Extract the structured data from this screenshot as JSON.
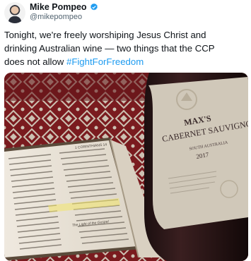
{
  "tweet": {
    "author_name": "Mike Pompeo",
    "handle": "@mikepompeo",
    "text_lines": [
      "Tonight, we're freely worshiping Jesus Christ and",
      "drinking Australian wine — two things that the CCP",
      "does not allow "
    ],
    "hashtag": "#FightForFreedom",
    "accent_color": "#1d9bf0",
    "verified_icon": "verified-badge-icon"
  },
  "photo": {
    "wine_label": {
      "brand": "MAX'S",
      "variety": "CABERNET SAUVIGNON",
      "region": "SOUTH AUSTRALIA",
      "vintage": "2017"
    },
    "book": {
      "page_heading": "1 CORINTHIANS 14",
      "section_heading": "The Light of the Gospel"
    }
  }
}
